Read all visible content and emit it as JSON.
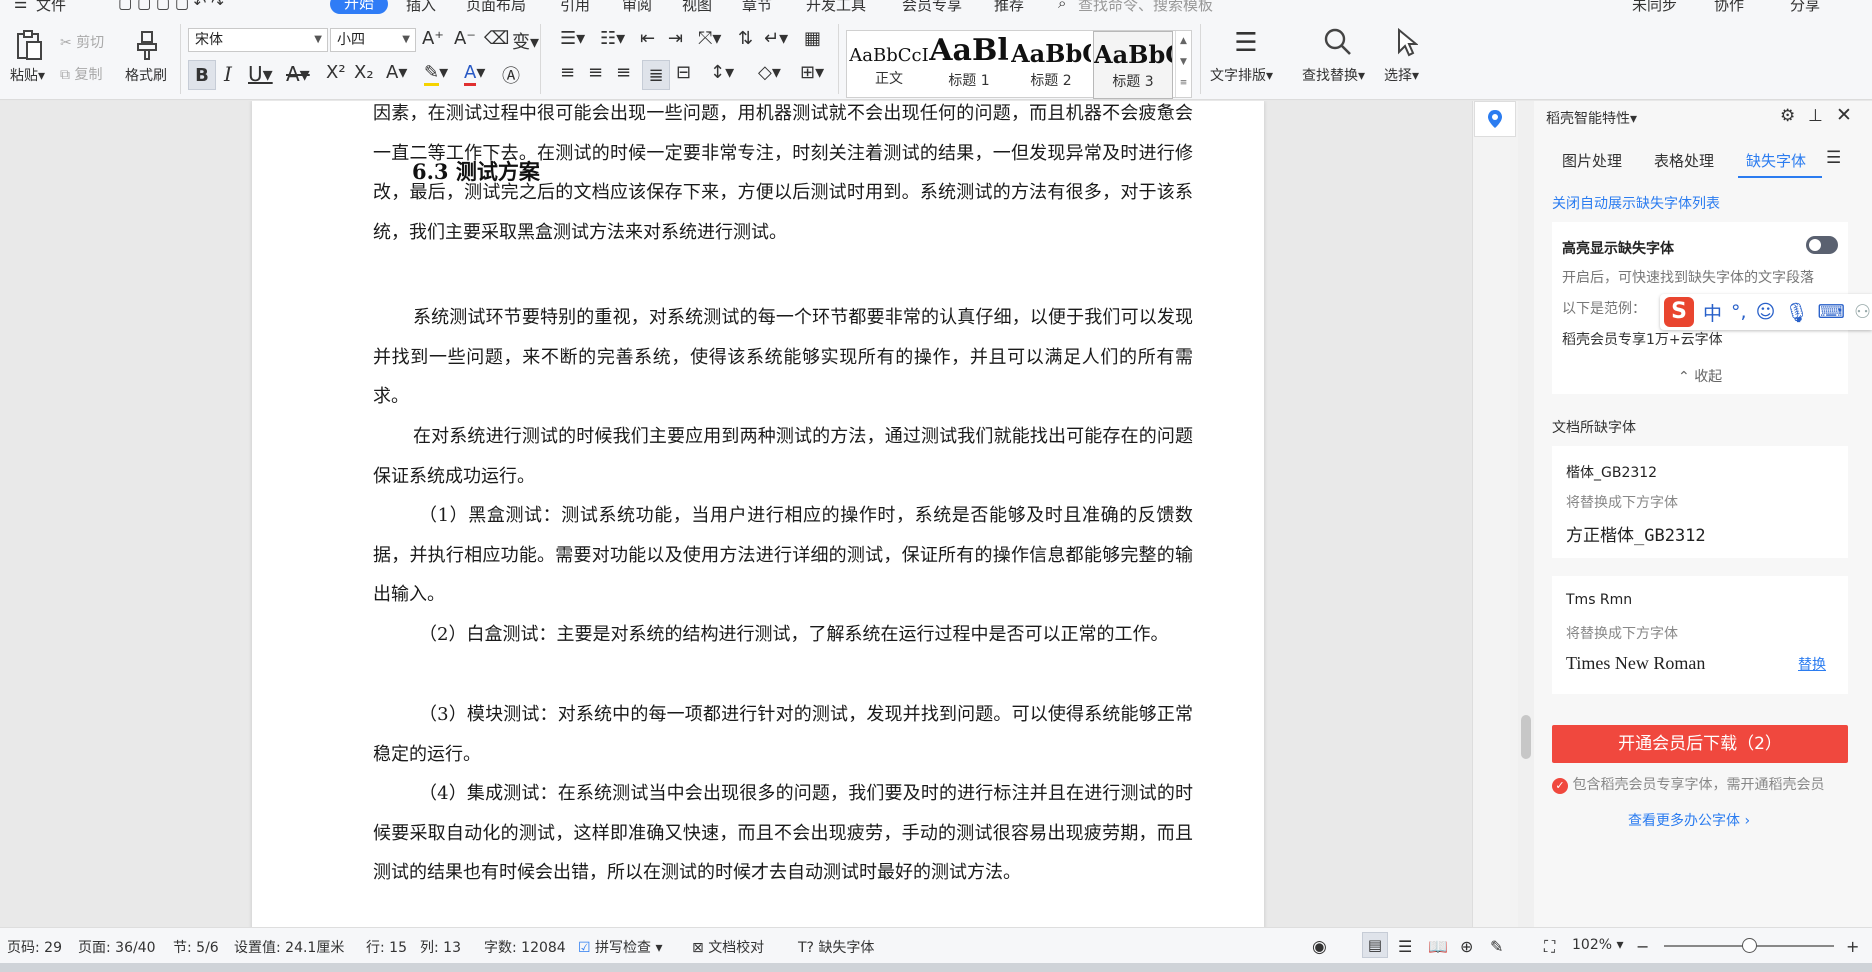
{
  "menu": {
    "file": "文件",
    "tabs": [
      "开始",
      "插入",
      "页面布局",
      "引用",
      "审阅",
      "视图",
      "章节",
      "开发工具",
      "会员专享",
      "推荐"
    ],
    "search": "查找命令、搜索模板",
    "sync": "未同步",
    "collab": "协作",
    "share": "分享"
  },
  "ribbon": {
    "paste": "粘贴",
    "cut": "剪切",
    "copy": "复制",
    "format_painter": "格式刷",
    "font_name": "宋体",
    "font_size": "小四",
    "styles": [
      {
        "sample": "AaBbCcI",
        "name": "正文"
      },
      {
        "sample": "AaBl",
        "name": "标题 1"
      },
      {
        "sample": "AaBbC",
        "name": "标题 2"
      },
      {
        "sample": "AaBbC",
        "name": "标题 3"
      }
    ],
    "text_layout": "文字排版",
    "find_replace": "查找替换",
    "select": "选择"
  },
  "document": {
    "heading": "6.3  测试方案",
    "paragraphs": [
      "因素，在测试过程中很可能会出现一些问题，用机器测试就不会出现任何的问题，而且机器不会疲惫会一直二等工作下去。在测试的时候一定要非常专注，时刻关注着测试的结果，一但发现异常及时进行修改，最后，测试完之后的文档应该保存下来，方便以后测试时用到。系统测试的方法有很多，对于该系统，我们主要采取黑盒测试方法来对系统进行测试。",
      "系统测试环节要特别的重视，对系统测试的每一个环节都要非常的认真仔细，以便于我们可以发现并找到一些问题，来不断的完善系统，使得该系统能够实现所有的操作，并且可以满足人们的所有需求。",
      "在对系统进行测试的时候我们主要应用到两种测试的方法，通过测试我们就能找出可能存在的问题保证系统成功运行。",
      "（1）黑盒测试：测试系统功能，当用户进行相应的操作时，系统是否能够及时且准确的反馈数据，并执行相应功能。需要对功能以及使用方法进行详细的测试，保证所有的操作信息都能够完整的输出输入。",
      "（2）白盒测试：主要是对系统的结构进行测试，了解系统在运行过程中是否可以正常的工作。",
      "（3）模块测试：对系统中的每一项都进行针对的测试，发现并找到问题。可以使得系统能够正常稳定的运行。",
      "（4）集成测试：在系统测试当中会出现很多的问题，我们要及时的进行标注并且在进行测试的时候要采取自动化的测试，这样即准确又快速，而且不会出现疲劳，手动的测试很容易出现疲劳期，而且测试的结果也有时候会出错，所以在测试的时候才去自动测试时最好的测试方法。"
    ]
  },
  "panel": {
    "title": "稻壳智能特性",
    "tabs": [
      "图片处理",
      "表格处理",
      "缺失字体"
    ],
    "close_auto": "关闭自动展示缺失字体列表",
    "highlight_title": "高亮显示缺失字体",
    "highlight_desc": "开启后，可快速找到缺失字体的文字段落",
    "example_label": "以下是范例：",
    "example_text": "稻壳会员专享1万+云字体",
    "collapse": "收起",
    "missing_title": "文档所缺字体",
    "fonts": [
      {
        "name": "楷体_GB2312",
        "hint": "将替换成下方字体",
        "replacement": "方正楷体_GB2312"
      },
      {
        "name": "Tms Rmn",
        "hint": "将替换成下方字体",
        "replacement": "Times New Roman",
        "action": "替换"
      }
    ],
    "download_button": "开通会员后下载（2）",
    "member_note": "包含稻壳会员专享字体，需开通稻壳会员",
    "more_link": "查看更多办公字体"
  },
  "ime": {
    "chinese": "中"
  },
  "status": {
    "page_code": "页码: 29",
    "page": "页面: 36/40",
    "section": "节: 5/6",
    "setting": "设置值: 24.1厘米",
    "row": "行: 15",
    "col": "列: 13",
    "word_count": "字数: 12084",
    "spell_check": "拼写检查",
    "doc_proof": "文档校对",
    "missing_font": "缺失字体",
    "zoom": "102%"
  }
}
